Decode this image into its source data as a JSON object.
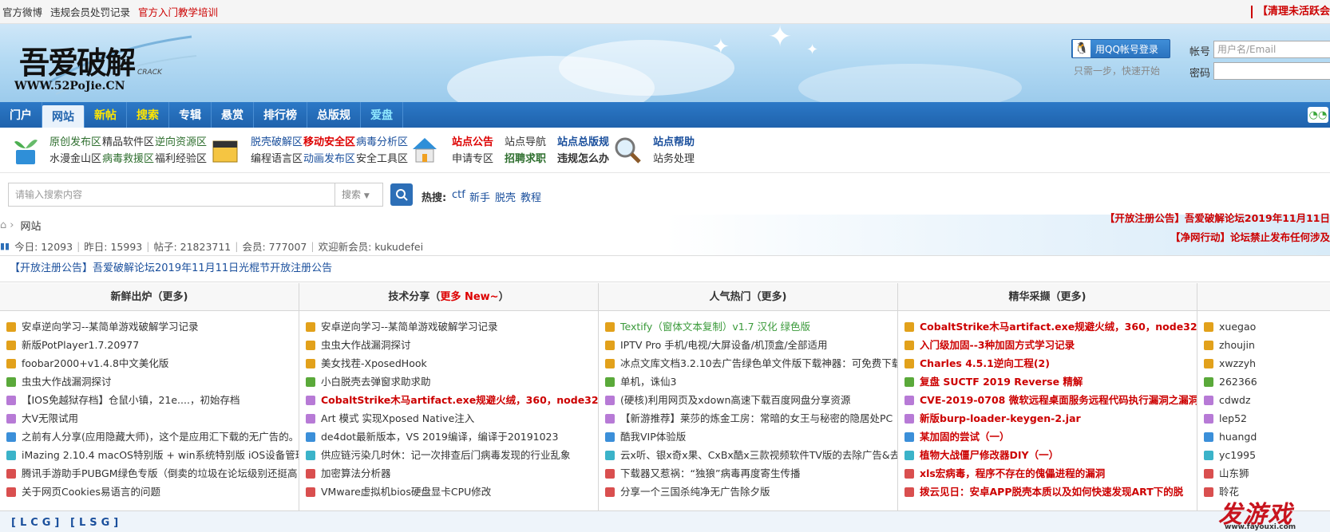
{
  "topbar": {
    "links": [
      "官方微博",
      "违规会员处罚记录"
    ],
    "training": "官方入门教学培训",
    "right_notice": "【清理未活跃会"
  },
  "logo": {
    "main": "吾爱破解",
    "url": "WWW.52PoJie.CN",
    "crack": "CRACK"
  },
  "login": {
    "qq_button": "用QQ帐号登录",
    "qq_tip": "只需一步，快速开始",
    "account_label": "帐号",
    "account_placeholder": "用户名/Email",
    "password_label": "密码"
  },
  "nav": {
    "items": [
      {
        "label": "门户",
        "style": "normal"
      },
      {
        "label": "网站",
        "style": "active"
      },
      {
        "label": "新帖",
        "style": "yellow"
      },
      {
        "label": "搜索",
        "style": "yellow"
      },
      {
        "label": "专辑",
        "style": "normal"
      },
      {
        "label": "悬赏",
        "style": "normal"
      },
      {
        "label": "排行榜",
        "style": "normal"
      },
      {
        "label": "总版规",
        "style": "normal"
      },
      {
        "label": "爱盘",
        "style": "cyan"
      }
    ]
  },
  "quick": {
    "group1_row1": [
      "原创发布区",
      "精品软件区",
      "逆向资源区"
    ],
    "group1_row2": [
      "水漫金山区",
      "病毒救援区",
      "福利经验区"
    ],
    "group2_row1": [
      "脱壳破解区",
      "移动安全区",
      "病毒分析区"
    ],
    "group2_row2": [
      "编程语言区",
      "动画发布区",
      "安全工具区"
    ],
    "group3_row1": [
      "站点公告",
      "站点导航"
    ],
    "group3_row2": [
      "申请专区",
      "招聘求职"
    ],
    "group4_row1": [
      "站点总版规"
    ],
    "group4_row2": [
      "违规怎么办"
    ],
    "group5_row1": [
      "站点帮助"
    ],
    "group5_row2": [
      "站务处理"
    ]
  },
  "search": {
    "placeholder": "请输入搜索内容",
    "select": "搜索",
    "hot_label": "热搜:",
    "hot": [
      "ctf",
      "新手",
      "脱壳",
      "教程"
    ]
  },
  "breadcrumb": {
    "current": "网站"
  },
  "stats": {
    "today": "今日: 12093",
    "yesterday": "昨日: 15993",
    "posts": "帖子: 21823711",
    "members": "会员: 777007",
    "welcome": "欢迎新会员: kukudefei"
  },
  "scroll_notices": [
    "【开放注册公告】吾爱破解论坛2019年11月11日",
    "【净网行动】论坛禁止发布任何涉及"
  ],
  "announcement": "【开放注册公告】吾爱破解论坛2019年11月11日光棍节开放注册公告",
  "columns": [
    {
      "title": "新鲜出炉（更多)",
      "items": [
        {
          "text": "安卓逆向学习--某简单游戏破解学习记录",
          "style": "normal",
          "color": "#e2a11b"
        },
        {
          "text": "新版PotPlayer1.7.20977",
          "style": "normal",
          "color": "#e2a11b"
        },
        {
          "text": "foobar2000+v1.4.8中文美化版",
          "style": "normal",
          "color": "#e2a11b"
        },
        {
          "text": "虫虫大作战漏洞探讨",
          "style": "normal",
          "color": "#5aa93a"
        },
        {
          "text": "【IOS免越狱存档】仓鼠小镇，21e....，初始存档",
          "style": "normal",
          "color": "#b77ad6"
        },
        {
          "text": "大V无限试用",
          "style": "normal",
          "color": "#b77ad6"
        },
        {
          "text": "之前有人分享(应用隐藏大师)，这个是应用汇下载的无广告的。",
          "style": "normal",
          "color": "#3b8fd9"
        },
        {
          "text": "iMazing 2.10.4 macOS特别版 + win系统特别版 iOS设备管理+存",
          "style": "normal",
          "color": "#3bb3c9"
        },
        {
          "text": "腾讯手游助手PUBGM绿色专版（倒卖的垃圾在论坛级别还挺高",
          "style": "normal",
          "color": "#d94f4f"
        },
        {
          "text": "关于网页Cookies易语言的问题",
          "style": "normal",
          "color": "#d94f4f"
        }
      ]
    },
    {
      "title": "技术分享（",
      "title_hl": "更多 New~",
      "title_end": "）",
      "items": [
        {
          "text": "安卓逆向学习--某简单游戏破解学习记录",
          "style": "normal",
          "color": "#e2a11b"
        },
        {
          "text": "虫虫大作战漏洞探讨",
          "style": "normal",
          "color": "#e2a11b"
        },
        {
          "text": "美女找茬-XposedHook",
          "style": "normal",
          "color": "#e2a11b"
        },
        {
          "text": "小白脱壳去弹窗求助求助",
          "style": "normal",
          "color": "#5aa93a"
        },
        {
          "text": "CobaltStrike木马artifact.exe规避火绒，360，node32沙盒的",
          "style": "bold-red",
          "color": "#b77ad6"
        },
        {
          "text": "Art 模式 实现Xposed Native注入",
          "style": "normal",
          "color": "#b77ad6"
        },
        {
          "text": "de4dot最新版本，VS 2019编译，编译于20191023",
          "style": "normal",
          "color": "#3b8fd9"
        },
        {
          "text": "供应链污染几时休：记一次排查后门病毒发现的行业乱象",
          "style": "normal",
          "color": "#3bb3c9"
        },
        {
          "text": "加密算法分析器",
          "style": "normal",
          "color": "#d94f4f"
        },
        {
          "text": "VMware虚拟机bios硬盘显卡CPU修改",
          "style": "normal",
          "color": "#d94f4f"
        }
      ]
    },
    {
      "title": "人气热门（更多)",
      "items": [
        {
          "text": "Textify（窗体文本复制）v1.7 汉化 绿色版",
          "style": "green",
          "color": "#e2a11b"
        },
        {
          "text": "IPTV Pro 手机/电视/大屏设备/机顶盒/全部适用",
          "style": "normal",
          "color": "#e2a11b"
        },
        {
          "text": "冰点文库文档3.2.10去广告绿色单文件版下载神器：可免费下载",
          "style": "normal",
          "color": "#e2a11b"
        },
        {
          "text": "单机，诛仙3",
          "style": "normal",
          "color": "#5aa93a"
        },
        {
          "text": "(硬核)利用网页及xdown高速下载百度网盘分享资源",
          "style": "normal",
          "color": "#b77ad6"
        },
        {
          "text": "【新游推荐】莱莎的炼金工房：常暗的女王与秘密的隐居处PC",
          "style": "normal",
          "color": "#b77ad6"
        },
        {
          "text": "酷我VIP体验版",
          "style": "normal",
          "color": "#3b8fd9"
        },
        {
          "text": "云x听、银x奇x果、CxBx酷x三款视频软件TV版的去除广告&去",
          "style": "normal",
          "color": "#3bb3c9"
        },
        {
          "text": "下载器又惹祸：“独狼”病毒再度寄生传播",
          "style": "normal",
          "color": "#d94f4f"
        },
        {
          "text": "分享一个三国杀纯净无广告除夕版",
          "style": "normal",
          "color": "#d94f4f"
        }
      ]
    },
    {
      "title": "精华采撷（更多)",
      "items": [
        {
          "text": "CobaltStrike木马artifact.exe规避火绒，360，node32沙盒的",
          "style": "bold-red",
          "color": "#e2a11b"
        },
        {
          "text": "入门级加固--3种加固方式学习记录",
          "style": "bold-red",
          "color": "#e2a11b"
        },
        {
          "text": "Charles 4.5.1逆向工程(2)",
          "style": "bold-red",
          "color": "#e2a11b"
        },
        {
          "text": "复盘 SUCTF 2019 Reverse 精解",
          "style": "bold-red",
          "color": "#5aa93a"
        },
        {
          "text": "CVE-2019-0708 微软远程桌面服务远程代码执行漏洞之漏洞分",
          "style": "bold-red",
          "color": "#b77ad6"
        },
        {
          "text": "新版burp-loader-keygen-2.jar",
          "style": "bold-red",
          "color": "#b77ad6"
        },
        {
          "text": "某加固的尝试（一）",
          "style": "bold-red",
          "color": "#3b8fd9"
        },
        {
          "text": "植物大战僵尸修改器DIY（一）",
          "style": "bold-red",
          "color": "#3bb3c9"
        },
        {
          "text": "xls宏病毒，程序不存在的傀儡进程的漏洞",
          "style": "bold-red",
          "color": "#d94f4f"
        },
        {
          "text": "拨云见日：安卓APP脱壳本质以及如何快速发现ART下的脱",
          "style": "bold-red",
          "color": "#d94f4f"
        }
      ]
    },
    {
      "title": "",
      "items": [
        {
          "text": "xuegao",
          "style": "normal",
          "color": "#e2a11b"
        },
        {
          "text": "zhoujin",
          "style": "normal",
          "color": "#e2a11b"
        },
        {
          "text": "xwzzyh",
          "style": "normal",
          "color": "#e2a11b"
        },
        {
          "text": "262366",
          "style": "normal",
          "color": "#5aa93a"
        },
        {
          "text": "cdwdz",
          "style": "normal",
          "color": "#b77ad6"
        },
        {
          "text": "lep52",
          "style": "normal",
          "color": "#b77ad6"
        },
        {
          "text": "huangd",
          "style": "normal",
          "color": "#3b8fd9"
        },
        {
          "text": "yc1995",
          "style": "normal",
          "color": "#3bb3c9"
        },
        {
          "text": "山东狮",
          "style": "normal",
          "color": "#d94f4f"
        },
        {
          "text": "聆花",
          "style": "normal",
          "color": "#d94f4f"
        }
      ]
    }
  ],
  "footer": {
    "links": [
      "[LCG]",
      "[LSG]"
    ]
  },
  "watermark": {
    "text": "发游戏",
    "url": "www.fayouxi.com"
  }
}
